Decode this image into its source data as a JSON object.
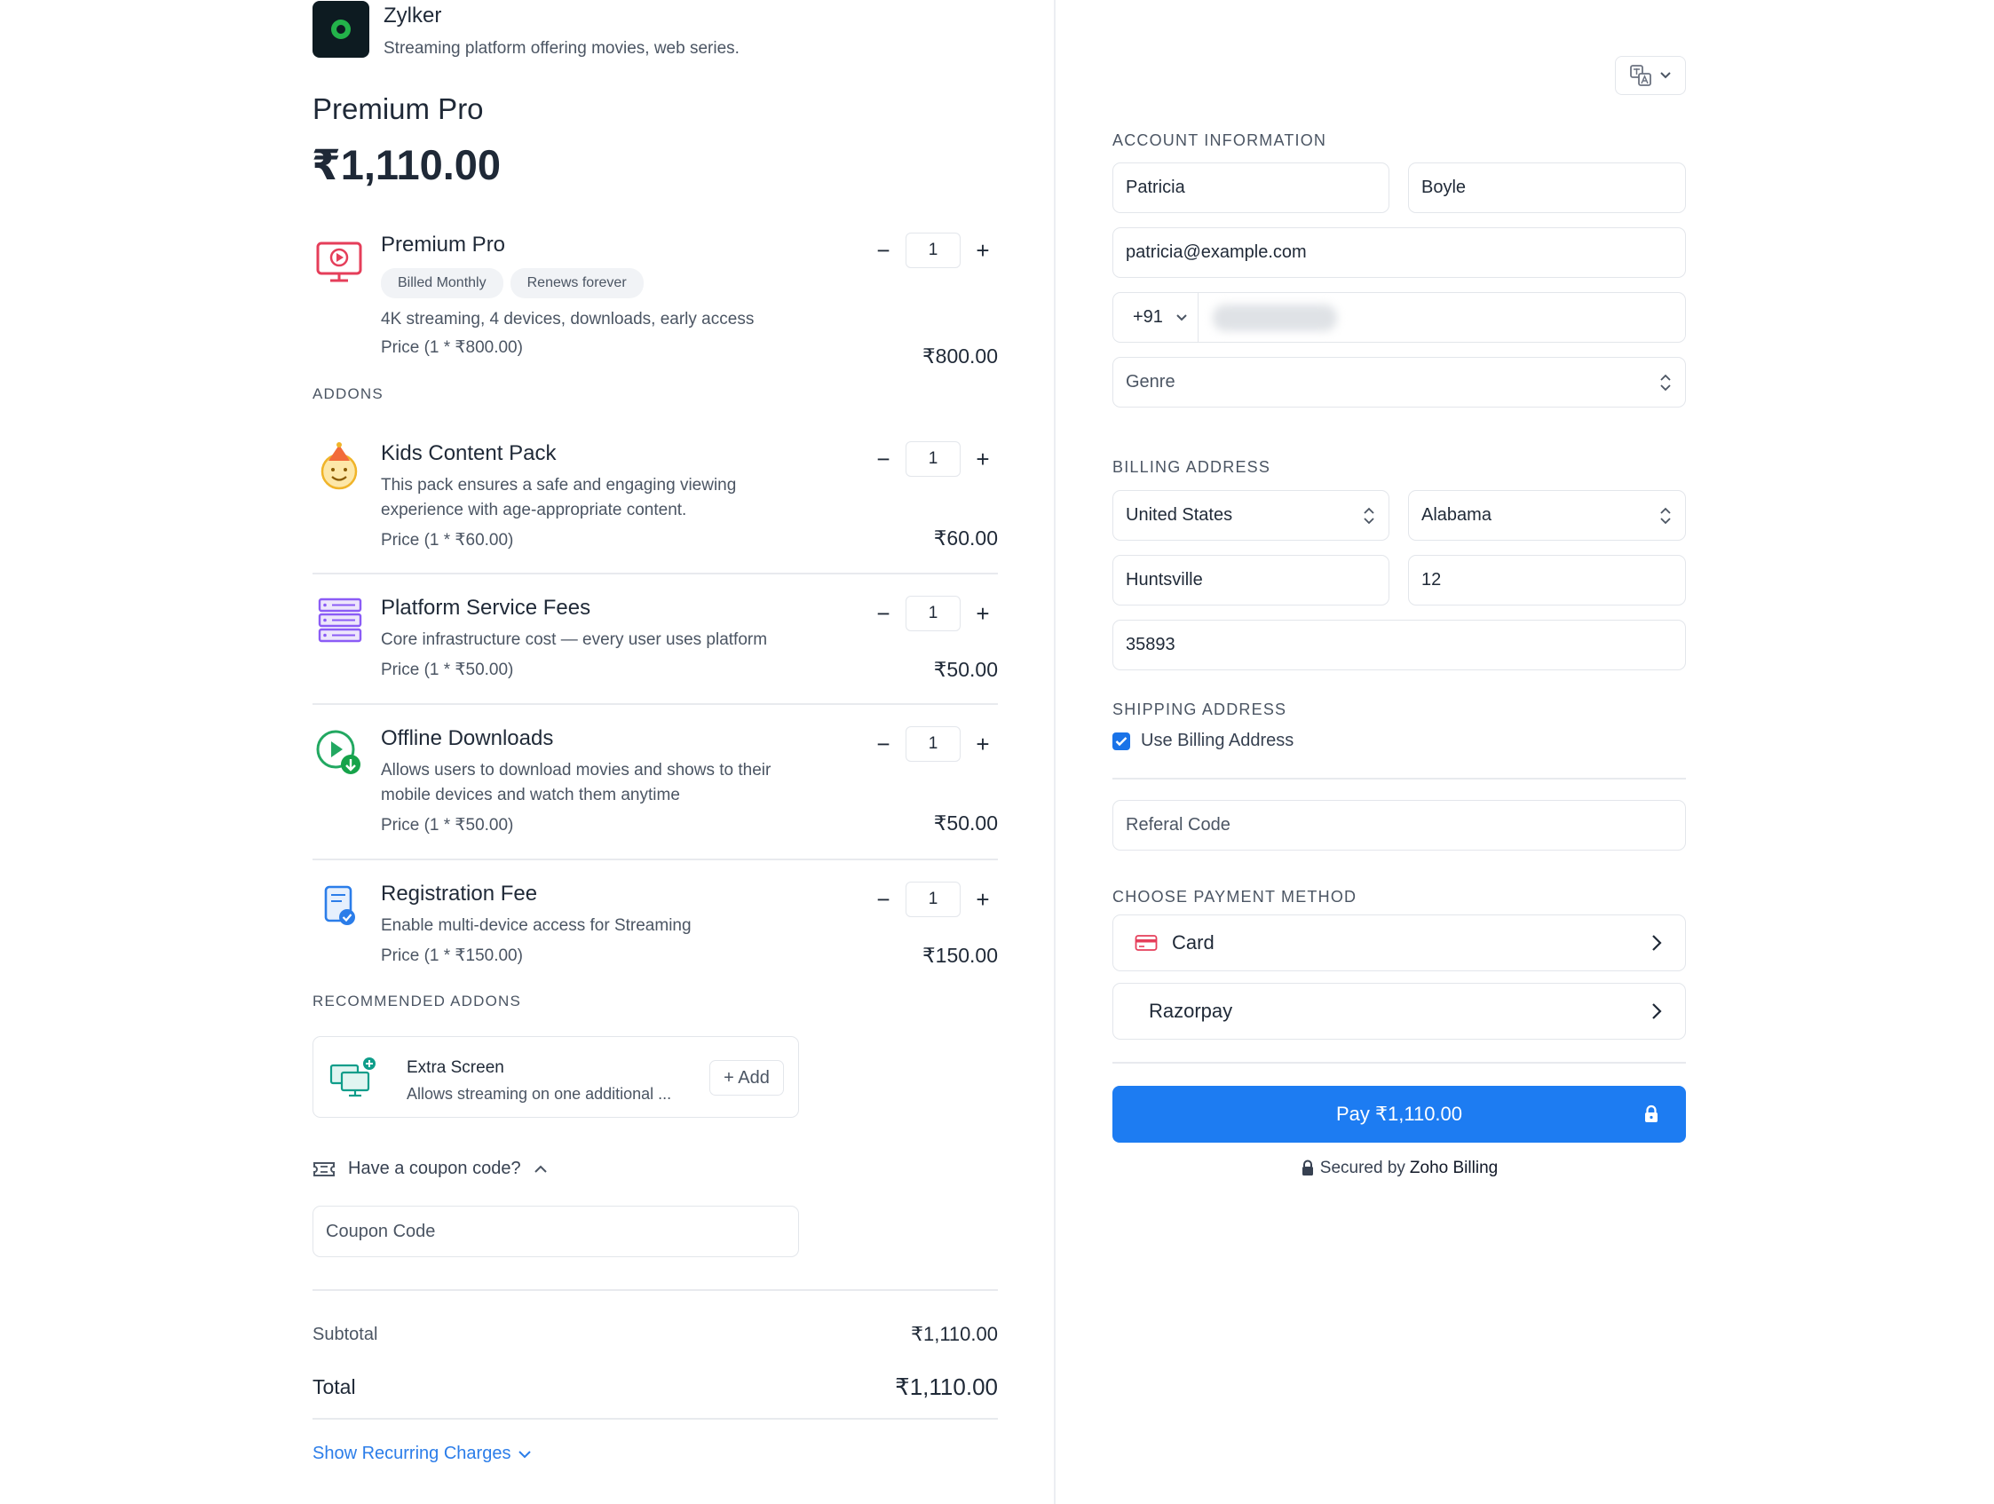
{
  "brand": {
    "name": "Zylker",
    "description": "Streaming platform offering movies, web series."
  },
  "plan": {
    "title": "Premium Pro",
    "price": "₹1,110.00"
  },
  "main_item": {
    "name": "Premium Pro",
    "tags": [
      "Billed Monthly",
      "Renews forever"
    ],
    "description": "4K streaming, 4 devices, downloads, early access",
    "price_line": "Price (1 * ₹800.00)",
    "quantity": "1",
    "total": "₹800.00",
    "icon": "tv-play-icon"
  },
  "addons_label": "ADDONS",
  "addons": [
    {
      "name": "Kids Content Pack",
      "description_lines": [
        "This pack ensures a safe and engaging viewing",
        "experience with age-appropriate content."
      ],
      "price_line": "Price (1 * ₹60.00)",
      "quantity": "1",
      "total": "₹60.00",
      "icon": "kid-face-icon"
    },
    {
      "name": "Platform Service Fees",
      "description_lines": [
        "Core infrastructure cost — every user uses platform"
      ],
      "price_line": "Price (1 * ₹50.00)",
      "quantity": "1",
      "total": "₹50.00",
      "icon": "server-stack-icon"
    },
    {
      "name": "Offline Downloads",
      "description_lines": [
        "Allows users to download movies and shows to their",
        "mobile devices and watch them anytime"
      ],
      "price_line": "Price (1 * ₹50.00)",
      "quantity": "1",
      "total": "₹50.00",
      "icon": "play-download-icon"
    },
    {
      "name": "Registration Fee",
      "description_lines": [
        "Enable multi-device access for Streaming"
      ],
      "price_line": "Price (1 * ₹150.00)",
      "quantity": "1",
      "total": "₹150.00",
      "icon": "registration-doc-icon"
    }
  ],
  "qty_controls": {
    "minus": "−",
    "plus": "+"
  },
  "recommended": {
    "label": "RECOMMENDED ADDONS",
    "name": "Extra Screen",
    "description": "Allows streaming on one additional ...",
    "add_label": "+ Add",
    "icon": "extra-screen-icon"
  },
  "coupon": {
    "toggle_label": "Have a coupon code?",
    "placeholder": "Coupon Code"
  },
  "summary": {
    "subtotal_label": "Subtotal",
    "subtotal_value": "₹1,110.00",
    "total_label": "Total",
    "total_value": "₹1,110.00",
    "recurring_label": "Show Recurring Charges"
  },
  "account": {
    "label": "ACCOUNT INFORMATION",
    "first_name": "Patricia",
    "last_name": "Boyle",
    "email": "patricia@example.com",
    "phone_code": "+91",
    "genre_placeholder": "Genre"
  },
  "billing": {
    "label": "BILLING ADDRESS",
    "country": "United States",
    "state": "Alabama",
    "city": "Huntsville",
    "street": "12",
    "zip": "35893"
  },
  "shipping": {
    "label": "SHIPPING ADDRESS",
    "use_billing_label": "Use Billing Address",
    "use_billing_checked": true
  },
  "referral_placeholder": "Referal Code",
  "payment": {
    "label": "CHOOSE PAYMENT METHOD",
    "methods": [
      "Card",
      "Razorpay"
    ],
    "pay_label": "Pay ₹1,110.00",
    "secured_prefix": "Secured by",
    "secured_brand": "Zoho Billing"
  },
  "colors": {
    "accent": "#1d7cf2",
    "link": "#2b7de9",
    "checkbox": "#1a73e8"
  }
}
